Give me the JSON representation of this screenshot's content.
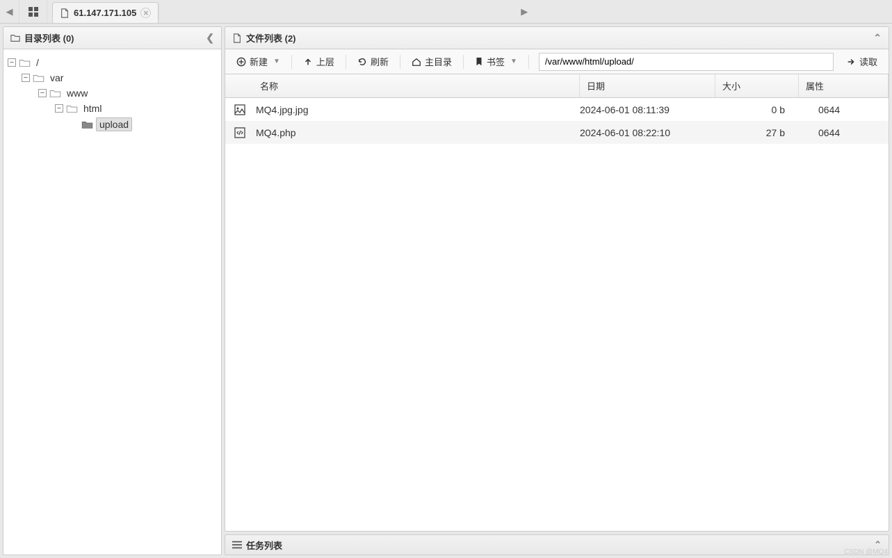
{
  "tab": {
    "title": "61.147.171.105"
  },
  "left_panel": {
    "title": "目录列表 (0)",
    "tree": {
      "root": "/",
      "var": "var",
      "www": "www",
      "html": "html",
      "upload": "upload"
    }
  },
  "right_panel": {
    "title": "文件列表 (2)",
    "toolbar": {
      "new": "新建",
      "up": "上层",
      "refresh": "刷新",
      "home": "主目录",
      "bookmark": "书签",
      "read": "读取"
    },
    "path": "/var/www/html/upload/",
    "columns": {
      "name": "名称",
      "date": "日期",
      "size": "大小",
      "perm": "属性"
    },
    "files": [
      {
        "name": "MQ4.jpg.jpg",
        "date": "2024-06-01 08:11:39",
        "size": "0 b",
        "perm": "0644",
        "icon": "image"
      },
      {
        "name": "MQ4.php",
        "date": "2024-06-01 08:22:10",
        "size": "27 b",
        "perm": "0644",
        "icon": "code"
      }
    ]
  },
  "taskbar": {
    "title": "任务列表"
  },
  "watermark": "CSDN @MQ4"
}
